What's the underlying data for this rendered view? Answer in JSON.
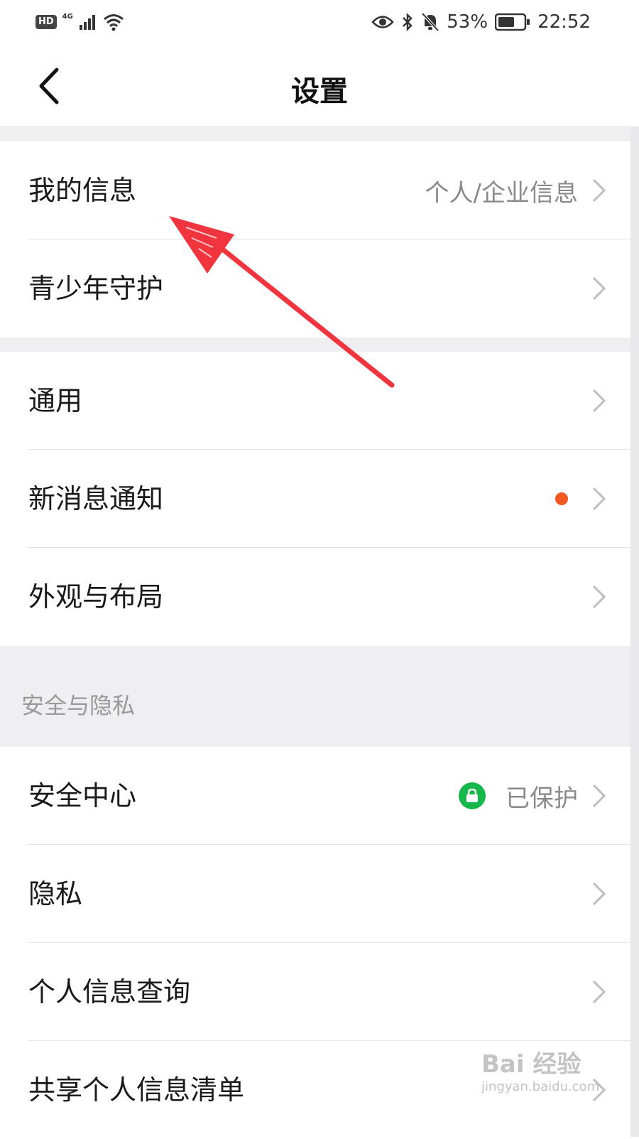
{
  "status_bar": {
    "hd": "HD",
    "network": "4G",
    "battery": "53%",
    "time": "22:52"
  },
  "header": {
    "title": "设置"
  },
  "rows": {
    "my_info": {
      "label": "我的信息",
      "value": "个人/企业信息"
    },
    "youth": {
      "label": "青少年守护"
    },
    "general": {
      "label": "通用"
    },
    "notify": {
      "label": "新消息通知"
    },
    "appearance": {
      "label": "外观与布局"
    },
    "security_center": {
      "label": "安全中心",
      "value": "已保护"
    },
    "privacy": {
      "label": "隐私"
    },
    "personal_query": {
      "label": "个人信息查询"
    },
    "share_list": {
      "label": "共享个人信息清单"
    }
  },
  "section": {
    "security_privacy": "安全与隐私"
  },
  "watermark": {
    "main": "Bai 经验",
    "sub": "jingyan.baidu.com"
  },
  "colors": {
    "accent_dot": "#f05a22",
    "lock_green": "#17b84b",
    "annotation_red": "#f0353f"
  }
}
